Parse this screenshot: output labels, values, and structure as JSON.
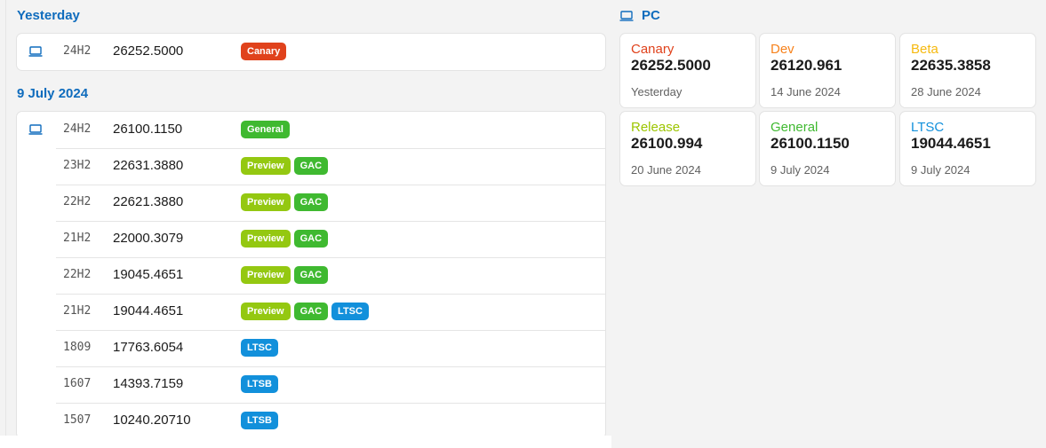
{
  "colors": {
    "heading": "#0f6cbd",
    "Canary": "#e0421c",
    "Dev": "#f7821c",
    "Beta": "#f6b90f",
    "Release": "#9cc500",
    "General": "#3fb930",
    "Preview": "#94c811",
    "GAC": "#3fb930",
    "LTSC": "#1290db",
    "LTSB": "#1290db"
  },
  "groups": [
    {
      "heading": "Yesterday",
      "rows": [
        {
          "version": "24H2",
          "build": "26252.5000",
          "badges": [
            "Canary"
          ],
          "icon": "laptop-icon"
        }
      ]
    },
    {
      "heading": "9 July 2024",
      "rows": [
        {
          "version": "24H2",
          "build": "26100.1150",
          "badges": [
            "General"
          ],
          "icon": "laptop-icon"
        },
        {
          "version": "23H2",
          "build": "22631.3880",
          "badges": [
            "Preview",
            "GAC"
          ]
        },
        {
          "version": "22H2",
          "build": "22621.3880",
          "badges": [
            "Preview",
            "GAC"
          ]
        },
        {
          "version": "21H2",
          "build": "22000.3079",
          "badges": [
            "Preview",
            "GAC"
          ]
        },
        {
          "version": "22H2",
          "build": "19045.4651",
          "badges": [
            "Preview",
            "GAC"
          ]
        },
        {
          "version": "21H2",
          "build": "19044.4651",
          "badges": [
            "Preview",
            "GAC",
            "LTSC"
          ]
        },
        {
          "version": "1809",
          "build": "17763.6054",
          "badges": [
            "LTSC"
          ]
        },
        {
          "version": "1607",
          "build": "14393.7159",
          "badges": [
            "LTSB"
          ]
        },
        {
          "version": "1507",
          "build": "10240.20710",
          "badges": [
            "LTSB"
          ]
        }
      ]
    }
  ],
  "pc": {
    "heading": "PC",
    "tiles": [
      {
        "channel": "Canary",
        "build": "26252.5000",
        "date": "Yesterday"
      },
      {
        "channel": "Dev",
        "build": "26120.961",
        "date": "14 June 2024"
      },
      {
        "channel": "Beta",
        "build": "22635.3858",
        "date": "28 June 2024"
      },
      {
        "channel": "Release",
        "build": "26100.994",
        "date": "20 June 2024"
      },
      {
        "channel": "General",
        "build": "26100.1150",
        "date": "9 July 2024"
      },
      {
        "channel": "LTSC",
        "build": "19044.4651",
        "date": "9 July 2024"
      }
    ]
  }
}
